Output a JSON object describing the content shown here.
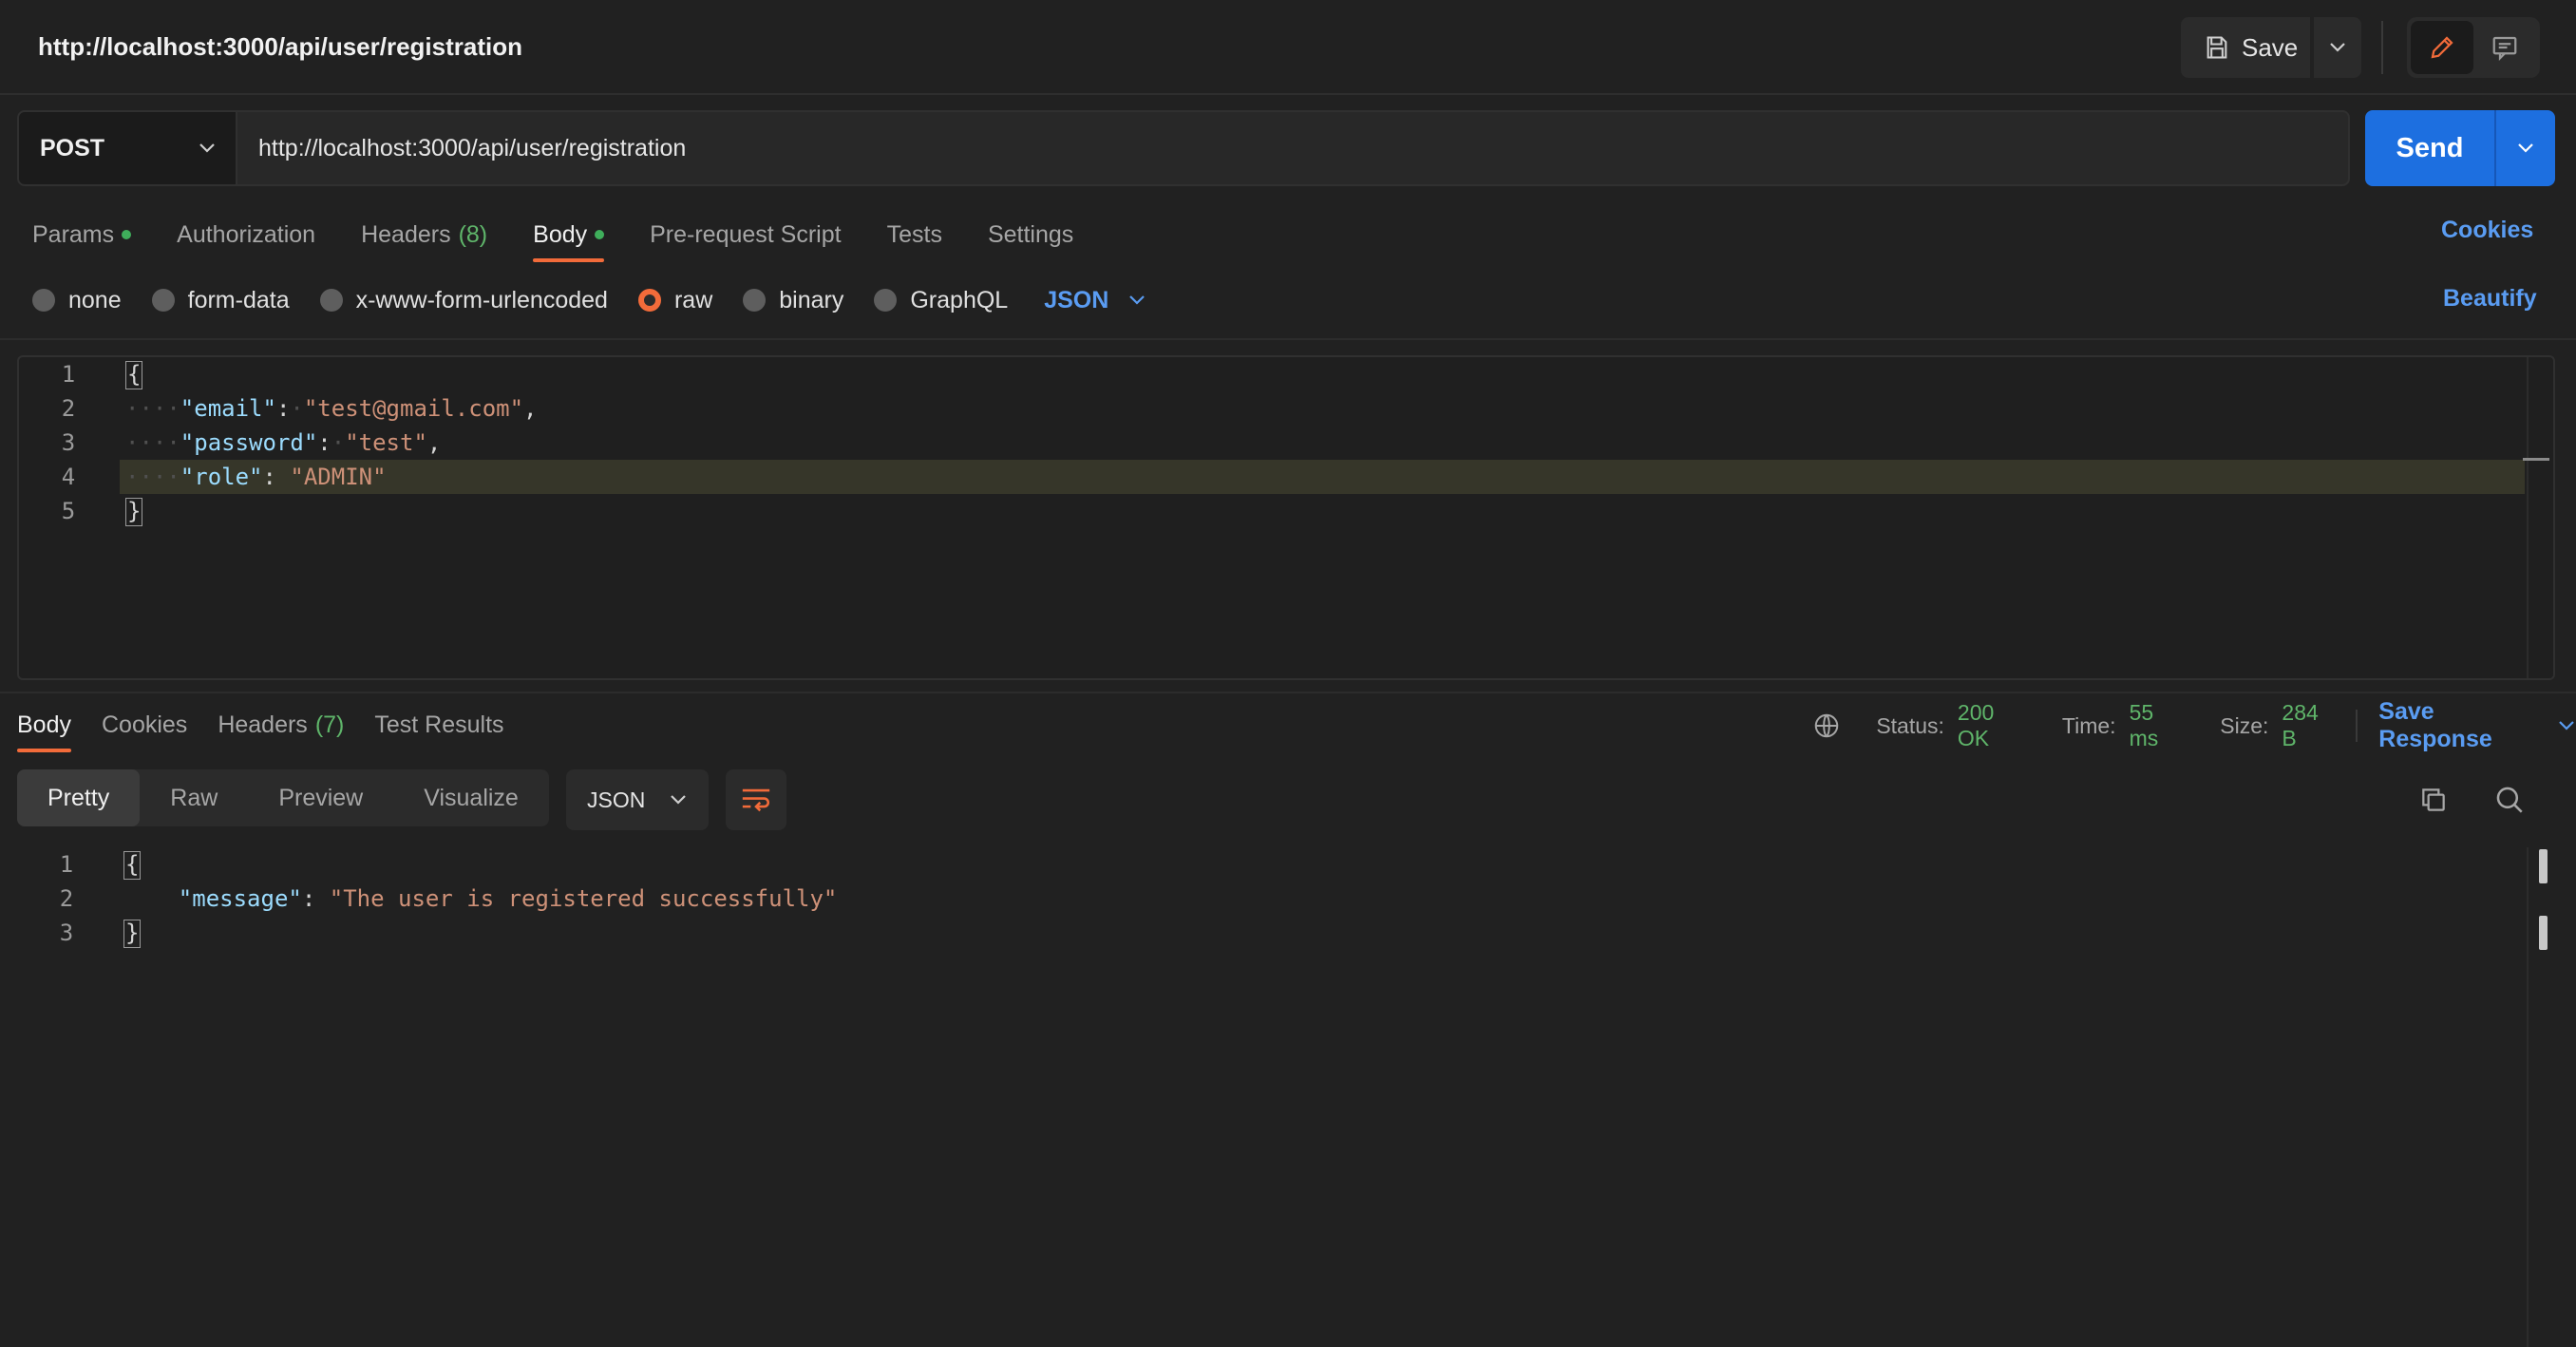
{
  "header": {
    "title": "http://localhost:3000/api/user/registration",
    "save_label": "Save"
  },
  "request": {
    "method": "POST",
    "url": "http://localhost:3000/api/user/registration",
    "send_label": "Send"
  },
  "request_tabs": {
    "params": "Params",
    "authorization": "Authorization",
    "headers": "Headers",
    "headers_count": "(8)",
    "body": "Body",
    "pre_request": "Pre-request Script",
    "tests": "Tests",
    "settings": "Settings",
    "active": "Body"
  },
  "cookies_label": "Cookies",
  "body_types": {
    "options": [
      "none",
      "form-data",
      "x-www-form-urlencoded",
      "raw",
      "binary",
      "GraphQL"
    ],
    "selected": "raw",
    "language": "JSON"
  },
  "beautify_label": "Beautify",
  "request_body": {
    "line_numbers": [
      "1",
      "2",
      "3",
      "4",
      "5"
    ],
    "open_brace": "{",
    "close_brace": "}",
    "fields": [
      {
        "key": "\"email\"",
        "value": "\"test@gmail.com\"",
        "trail": ","
      },
      {
        "key": "\"password\"",
        "value": "\"test\"",
        "trail": ","
      },
      {
        "key": "\"role\"",
        "value": "\"ADMIN\"",
        "trail": ""
      }
    ],
    "highlighted_line": "4"
  },
  "response_tabs": {
    "body": "Body",
    "cookies": "Cookies",
    "headers": "Headers",
    "headers_count": "(7)",
    "test_results": "Test Results",
    "active": "Body"
  },
  "response_meta": {
    "status_label": "Status:",
    "status_value": "200 OK",
    "time_label": "Time:",
    "time_value": "55 ms",
    "size_label": "Size:",
    "size_value": "284 B",
    "save_response": "Save Response"
  },
  "response_toolbar": {
    "views": [
      "Pretty",
      "Raw",
      "Preview",
      "Visualize"
    ],
    "active_view": "Pretty",
    "language": "JSON"
  },
  "response_body": {
    "line_numbers": [
      "1",
      "2",
      "3"
    ],
    "open_brace": "{",
    "close_brace": "}",
    "key": "\"message\"",
    "value": "\"The user is registered successfully\""
  },
  "colors": {
    "accent": "#f26b3a",
    "primary": "#1d6fe0",
    "link": "#5a9cf2",
    "success": "#5fb56a"
  }
}
